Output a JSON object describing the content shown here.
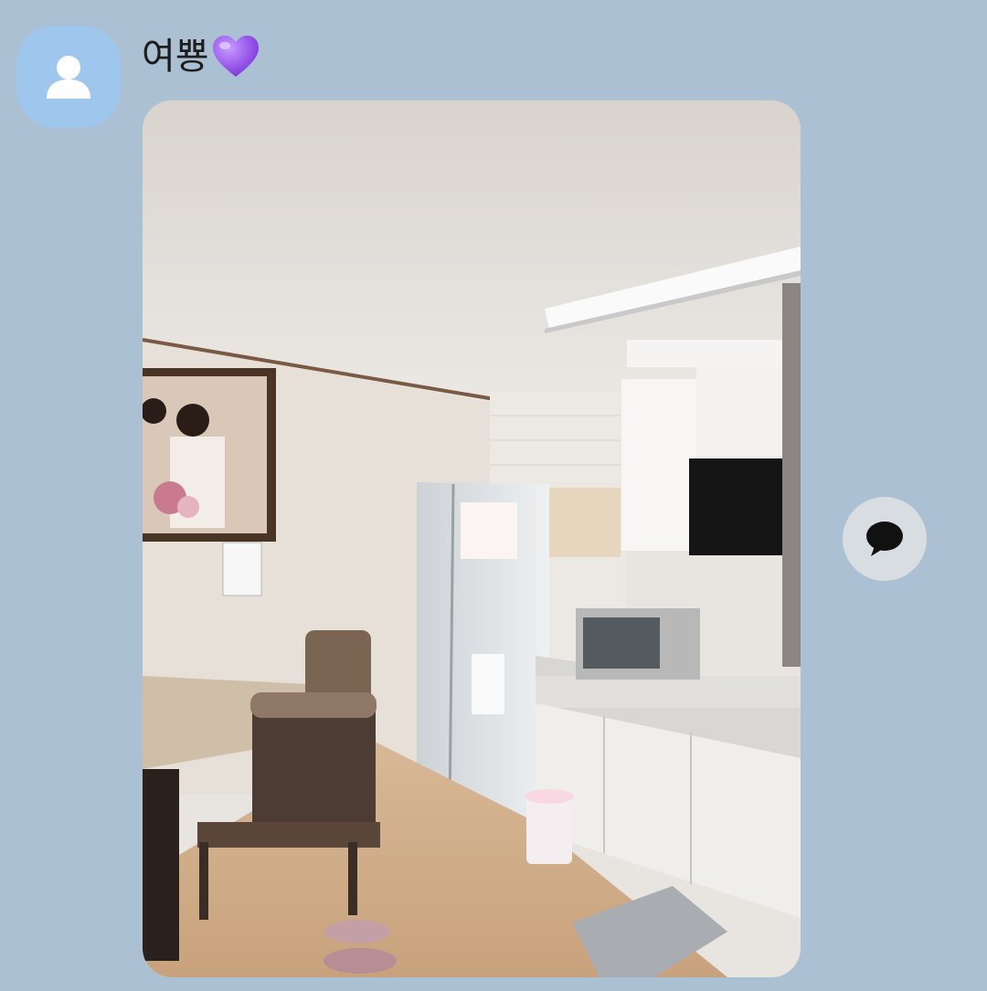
{
  "message": {
    "sender_name": "여뿅",
    "sender_emoji": "purple-heart-icon",
    "avatar_icon": "default-profile-icon",
    "attachment_type": "photo",
    "reply_icon": "speech-bubble-icon"
  },
  "colors": {
    "background": "#abc1d3",
    "avatar_bg": "#9fc6ec",
    "reply_button_bg": "#d8dde1",
    "heart": "#9b59ec"
  }
}
